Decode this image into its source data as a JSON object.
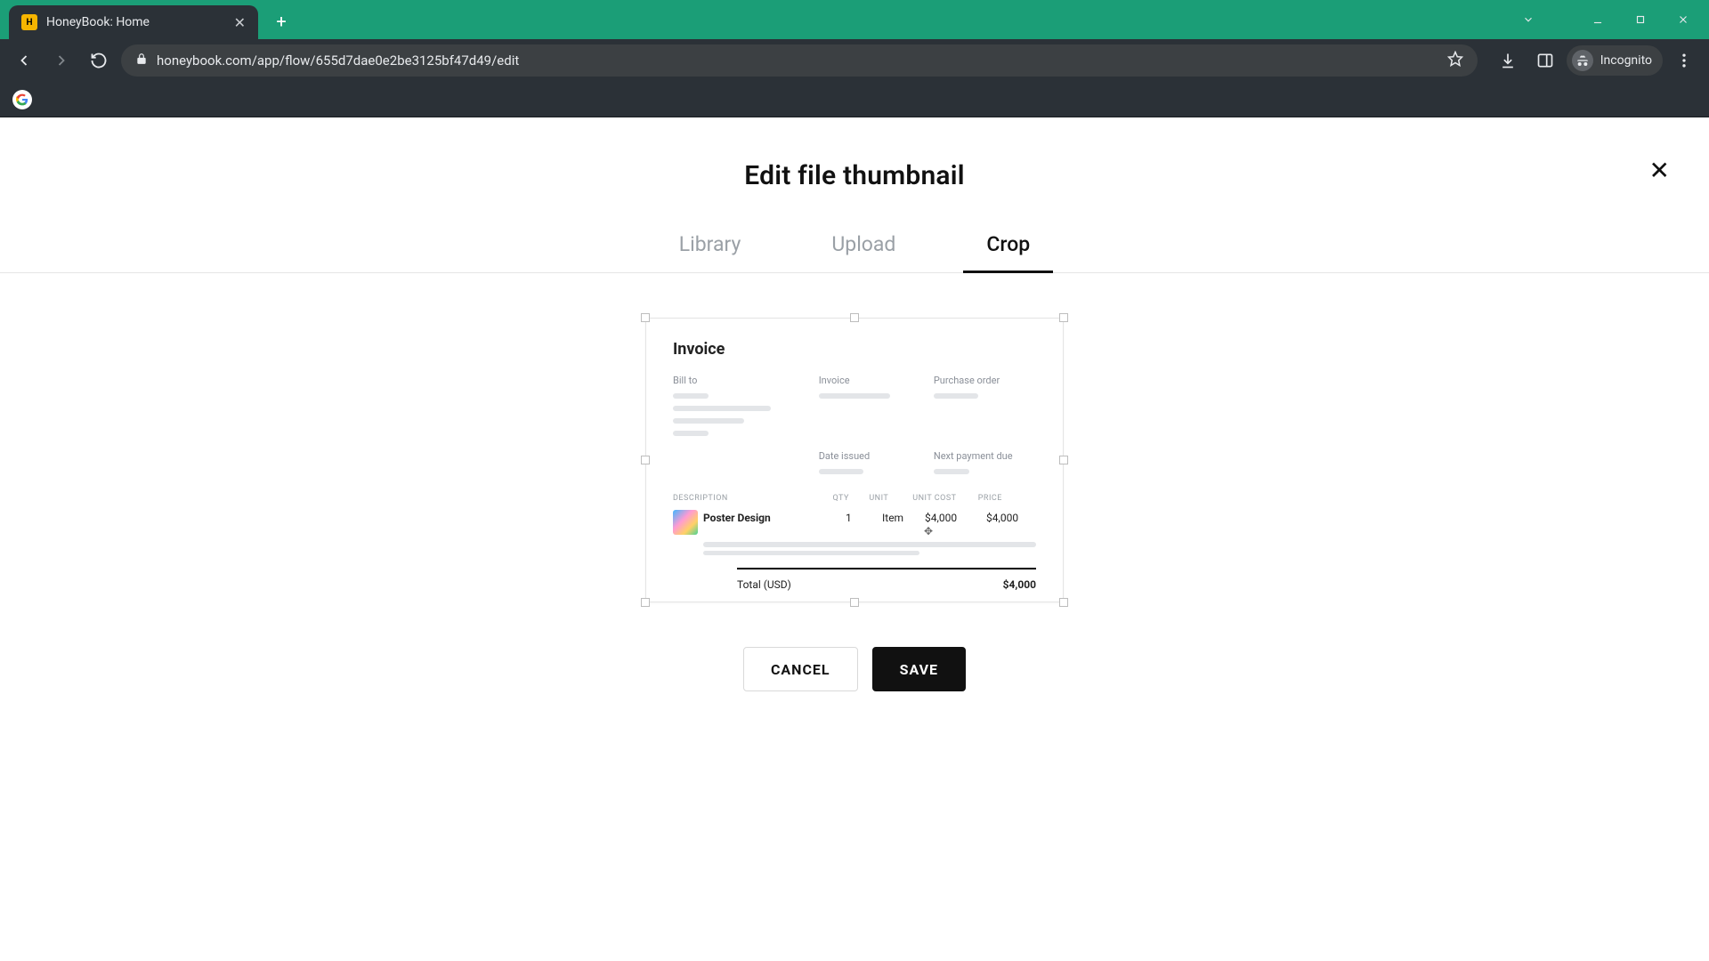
{
  "browser": {
    "tab_title": "HoneyBook: Home",
    "url": "honeybook.com/app/flow/655d7dae0e2be3125bf47d49/edit",
    "incognito_label": "Incognito"
  },
  "modal": {
    "title": "Edit file thumbnail",
    "tabs": {
      "library": "Library",
      "upload": "Upload",
      "crop": "Crop"
    },
    "actions": {
      "cancel": "CANCEL",
      "save": "SAVE"
    }
  },
  "preview": {
    "title": "Invoice",
    "meta": {
      "bill_to": "Bill to",
      "invoice": "Invoice",
      "purchase_order": "Purchase order",
      "date_issued": "Date issued",
      "next_payment_due": "Next payment due"
    },
    "table_headers": {
      "desc": "DESCRIPTION",
      "qty": "QTY",
      "unit": "UNIT",
      "unit_cost": "UNIT COST",
      "price": "PRICE"
    },
    "line_item": {
      "name": "Poster Design",
      "qty": "1",
      "unit": "Item",
      "unit_cost": "$4,000",
      "price": "$4,000"
    },
    "total_label": "Total (USD)",
    "total_value": "$4,000"
  }
}
